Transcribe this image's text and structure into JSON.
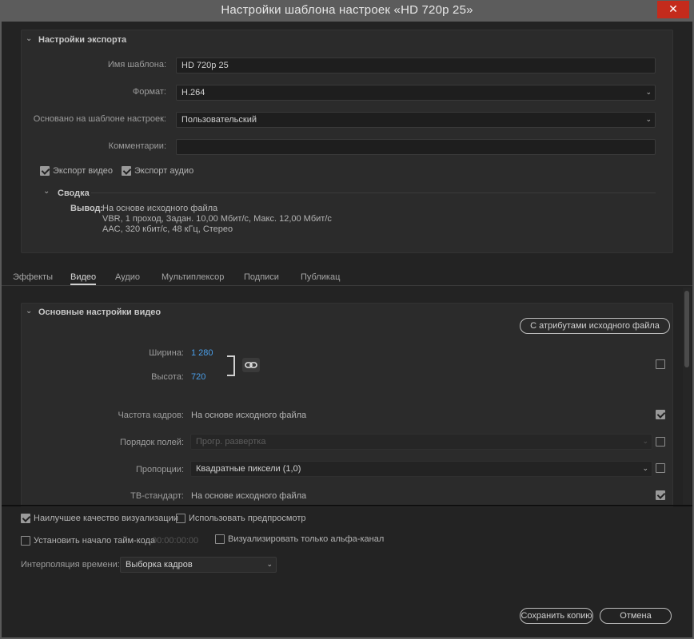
{
  "window": {
    "title": "Настройки шаблона настроек «HD 720p 25»",
    "close_glyph": "✕"
  },
  "export": {
    "section_title": "Настройки экспорта",
    "preset_name_label": "Имя шаблона:",
    "preset_name_value": "HD 720p 25",
    "format_label": "Формат:",
    "format_value": "H.264",
    "based_on_label": "Основано на шаблоне настроек:",
    "based_on_value": "Пользовательский",
    "comments_label": "Комментарии:",
    "comments_value": "",
    "export_video_label": "Экспорт видео",
    "export_video_checked": true,
    "export_audio_label": "Экспорт аудио",
    "export_audio_checked": true,
    "summary_title": "Сводка",
    "output_label": "Вывод:",
    "output_lines": [
      "На основе исходного файла",
      "VBR, 1 проход, Задан. 10,00 Мбит/с, Макс. 12,00 Мбит/с",
      "AAC, 320 кбит/с, 48 кГц, Стерео"
    ]
  },
  "tabs": [
    "Эффекты",
    "Видео",
    "Аудио",
    "Мультиплексор",
    "Подписи",
    "Публикац"
  ],
  "active_tab": "Видео",
  "video": {
    "section_title": "Основные настройки видео",
    "match_source_button": "С атрибутами исходного файла",
    "width_label": "Ширина:",
    "width_value": "1 280",
    "height_label": "Высота:",
    "height_value": "720",
    "frame_rate_label": "Частота кадров:",
    "frame_rate_value": "На основе исходного файла",
    "field_order_label": "Порядок полей:",
    "field_order_value": "Прогр. развертка",
    "aspect_label": "Пропорции:",
    "aspect_value": "Квадратные пиксели (1,0)",
    "tv_standard_label": "ТВ-стандарт:",
    "tv_standard_value": "На основе исходного файла",
    "size_match_checked": false,
    "frame_rate_match_checked": true,
    "field_order_match_checked": false,
    "aspect_match_checked": false,
    "tv_standard_match_checked": true
  },
  "bottom": {
    "max_render_quality_label": "Наилучшее качество визуализации",
    "max_render_quality_checked": true,
    "use_previews_label": "Использовать предпросмотр",
    "use_previews_checked": false,
    "set_start_timecode_label": "Установить начало тайм-кода",
    "set_start_timecode_checked": false,
    "timecode_value": "00:00:00:00",
    "render_alpha_only_label": "Визуализировать только альфа-канал",
    "render_alpha_only_checked": false,
    "time_interpolation_label": "Интерполяция времени:",
    "time_interpolation_value": "Выборка кадров",
    "save_copy_button": "Сохранить копию",
    "cancel_button": "Отмена"
  },
  "colors": {
    "accent_blue": "#4a9ee8",
    "close_red": "#c42b1c",
    "background": "#232323"
  }
}
